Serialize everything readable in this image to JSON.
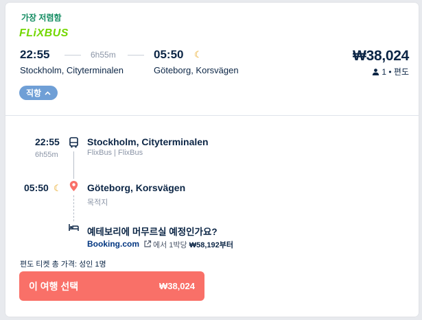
{
  "badge": {
    "cheapest": "가장 저렴함"
  },
  "operator_logo": "FLiXBUS",
  "summary": {
    "departure_time": "22:55",
    "departure_station": "Stockholm, Cityterminalen",
    "duration": "6h55m",
    "arrival_time": "05:50",
    "arrival_station": "Göteborg, Korsvägen",
    "price": "₩38,024",
    "passengers": "1",
    "trip_type": "편도",
    "direct_label": "직항"
  },
  "itinerary": {
    "departure_time": "22:55",
    "duration": "6h55m",
    "departure_station": "Stockholm, Cityterminalen",
    "operator": "FlixBus | FlixBus",
    "arrival_time": "05:50",
    "arrival_station": "Göteborg, Korsvägen",
    "destination_label": "목적지"
  },
  "hotel": {
    "question": "예테보리에 머무르실 예정인가요?",
    "provider": "Booking.com",
    "from_text": "에서 1박당",
    "price": "₩58,192부터"
  },
  "footer": {
    "total_label": "편도 티켓 총 가격: 성인 1명",
    "select_label": "이 여행 선택",
    "select_price": "₩38,024"
  },
  "colors": {
    "brand_green": "#73d700",
    "cheapest_green": "#0f8a5f",
    "direct_chip": "#6f9fd6",
    "select_button": "#f97068",
    "moon": "#e59a00"
  }
}
